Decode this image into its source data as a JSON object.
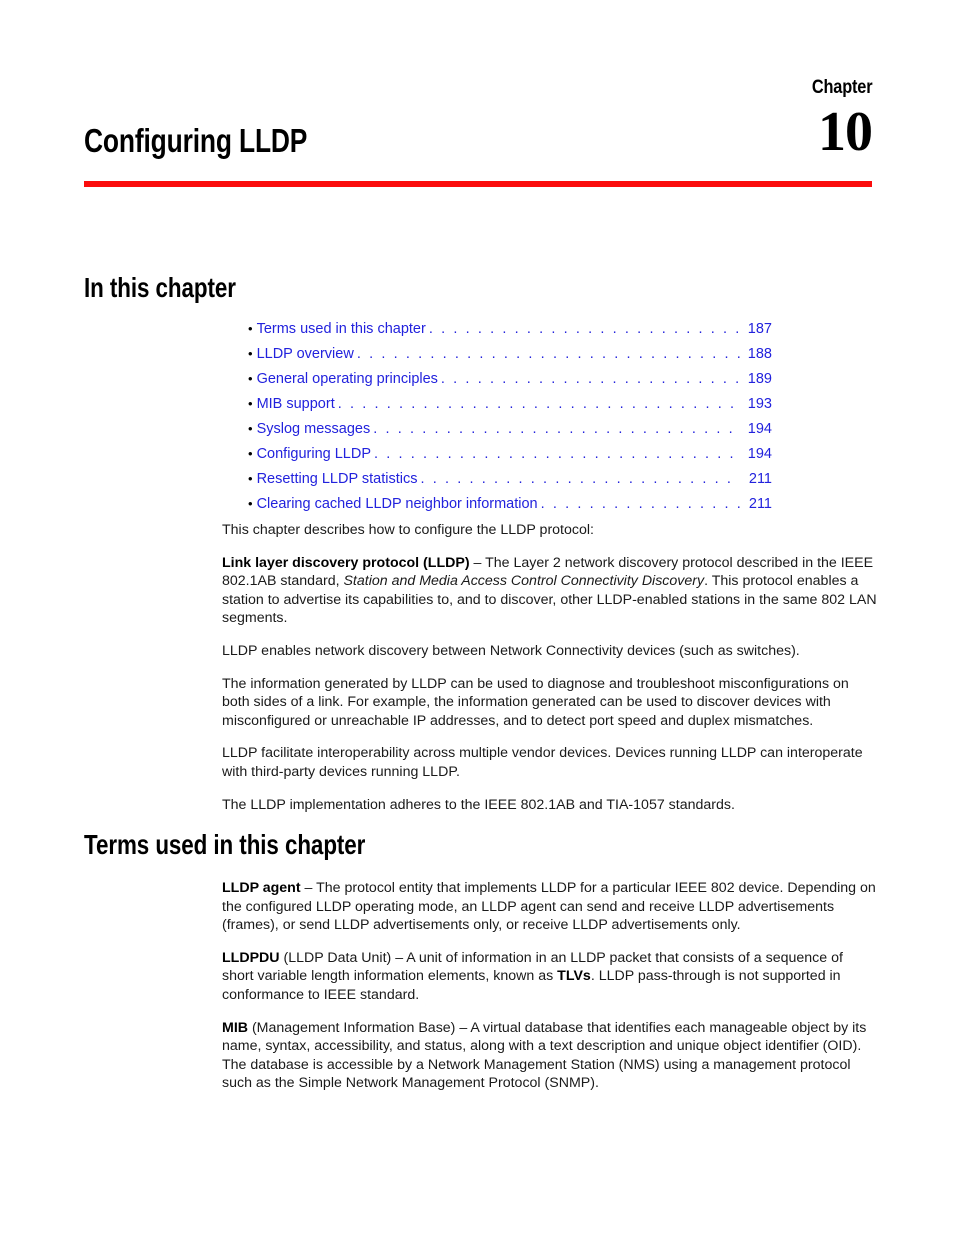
{
  "chapter": {
    "label": "Chapter",
    "number": "10",
    "title": "Configuring LLDP",
    "rule_color": "#fb0d0d"
  },
  "link_color": "#2222dd",
  "sections": {
    "in_this_chapter": {
      "heading": "In this chapter",
      "toc": [
        {
          "bullet": "•",
          "label": "Terms used in this chapter",
          "leader": ". . . . . . . . . . . . . . . . . . . . . . . . . . . . . . . . . . . . . . . . . . . . . . .",
          "page": "187"
        },
        {
          "bullet": "•",
          "label": "LLDP overview",
          "leader": ". . . . . . . . . . . . . . . . . . . . . . . . . . . . . . . . . . . . . . . . . . . . . . . . . . . . . .",
          "page": "188"
        },
        {
          "bullet": "•",
          "label": "General operating principles",
          "leader": ". . . . . . . . . . . . . . . . . . . . . . . . . . . . . . . . . . . . . .",
          "page": "189"
        },
        {
          "bullet": "•",
          "label": "MIB support",
          "leader": ". . . . . . . . . . . . . . . . . . . . . . . . . . . . . . . . . . . . . . . . . . . . . . . . . . . . . . . .",
          "page": "193"
        },
        {
          "bullet": "•",
          "label": "Syslog messages",
          "leader": ". . . . . . . . . . . . . . . . . . . . . . . . . . . . . . . . . . . . . . . . . . . . . . . . . . .",
          "page": "194"
        },
        {
          "bullet": "•",
          "label": "Configuring LLDP",
          "leader": ". . . . . . . . . . . . . . . . . . . . . . . . . . . . . . . . . . . . . . . . . . . . . . . . . . .",
          "page": "194"
        },
        {
          "bullet": "•",
          "label": "Resetting LLDP statistics",
          "leader": ". . . . . . . . . . . . . . . . . . . . . . . . . . . . . . . . . . . . . . . . . .",
          "page": "211"
        },
        {
          "bullet": "•",
          "label": "Clearing cached LLDP neighbor information",
          "leader": ". . . . . . . . . . . . . . . . . . . . . . . . .",
          "page": "211"
        }
      ],
      "paragraphs": {
        "intro": "This chapter describes how to configure the LLDP protocol:",
        "lldp_def_term": "Link layer discovery protocol (LLDP)",
        "lldp_def_part1": " – The Layer 2 network discovery protocol described in the IEEE 802.1AB standard, ",
        "lldp_def_italic": "Station and Media Access Control Connectivity Discovery",
        "lldp_def_part2": ".  This protocol enables a station to advertise its capabilities to, and to discover, other LLDP-enabled stations in the same 802 LAN segments.",
        "discovery": "LLDP enables network discovery between Network Connectivity devices (such as switches).",
        "troubleshoot": "The information generated by LLDP can be used to diagnose and troubleshoot misconfigurations on both sides of a link.  For example, the information generated can be used to discover devices with misconfigured or unreachable IP addresses, and to detect port speed and duplex mismatches.",
        "interop": "LLDP facilitate interoperability across multiple vendor devices. Devices running LLDP can interoperate with third-party devices running LLDP.",
        "standards": "The LLDP implementation adheres to the IEEE 802.1AB and TIA-1057 standards."
      }
    },
    "terms_used": {
      "heading": "Terms used in this chapter",
      "definitions": {
        "lldp_agent_term": "LLDP agent",
        "lldp_agent_text": " – The protocol entity that implements LLDP for a particular IEEE 802 device. Depending on the configured LLDP operating mode, an LLDP agent can send and receive LLDP advertisements (frames), or send LLDP advertisements only, or receive LLDP advertisements only.",
        "lldpdu_term": "LLDPDU",
        "lldpdu_part1": " (LLDP Data Unit) – A unit of information in an LLDP packet that consists of a sequence of short variable length information elements, known as ",
        "lldpdu_bold_tlvs": "TLVs",
        "lldpdu_part2": ". LLDP pass-through is not supported in conformance to IEEE standard.",
        "mib_term": "MIB",
        "mib_text": " (Management Information Base) – A virtual database that identifies each manageable object by its name, syntax, accessibility, and status, along with a text description and unique object identifier (OID).  The database is  accessible by a Network Management Station (NMS) using a management protocol such as the Simple Network Management Protocol (SNMP)."
      }
    }
  }
}
